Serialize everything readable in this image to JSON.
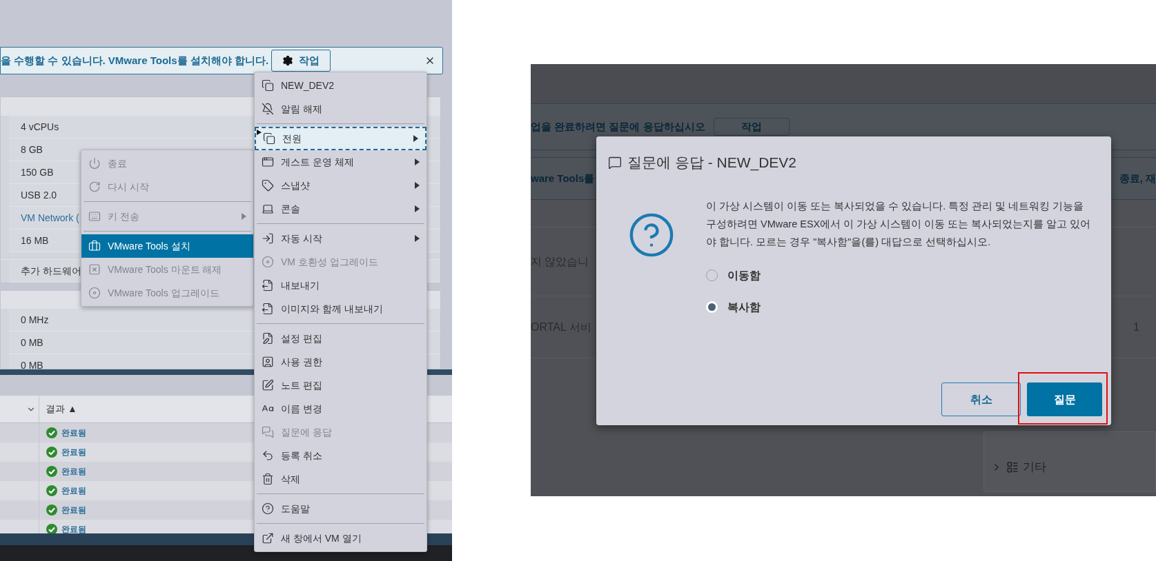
{
  "left_screen": {
    "banner": {
      "text": "을 수행할 수 있습니다. VMware Tools를 설치해야 합니다.",
      "action_button": "작업"
    },
    "hardware_rows": [
      {
        "value": "4 vCPUs",
        "kind": "text"
      },
      {
        "value": "8 GB",
        "kind": "text"
      },
      {
        "value": "150 GB",
        "kind": "text"
      },
      {
        "value": "USB 2.0",
        "kind": "text"
      },
      {
        "value": "VM Network (",
        "kind": "link"
      },
      {
        "value": "16 MB",
        "kind": "text"
      },
      {
        "value": "추가 하드웨어",
        "kind": "text"
      }
    ],
    "usage_rows": [
      "0 MHz",
      "0 MB",
      "0 MB"
    ],
    "tasks_table": {
      "columns": [
        "결과 ▲"
      ],
      "rows": [
        {
          "result": "완료됨"
        },
        {
          "result": "완료됨"
        },
        {
          "result": "완료됨"
        },
        {
          "result": "완료됨"
        },
        {
          "result": "완료됨"
        },
        {
          "result": "완료됨"
        }
      ]
    },
    "actions_menu": [
      {
        "kind": "item",
        "label": "NEW_DEV2",
        "disabled": false,
        "selected": false,
        "has_submenu": false
      },
      {
        "kind": "item",
        "label": "알림 해제",
        "disabled": false,
        "selected": false,
        "has_submenu": false
      },
      {
        "kind": "divider"
      },
      {
        "kind": "item",
        "label": "전원",
        "disabled": false,
        "selected": true,
        "has_submenu": true
      },
      {
        "kind": "item",
        "label": "게스트 운영 체제",
        "disabled": false,
        "selected": false,
        "has_submenu": true
      },
      {
        "kind": "item",
        "label": "스냅샷",
        "disabled": false,
        "selected": false,
        "has_submenu": true
      },
      {
        "kind": "item",
        "label": "콘솔",
        "disabled": false,
        "selected": false,
        "has_submenu": true
      },
      {
        "kind": "divider"
      },
      {
        "kind": "item",
        "label": "자동 시작",
        "disabled": false,
        "selected": false,
        "has_submenu": true
      },
      {
        "kind": "item",
        "label": "VM 호환성 업그레이드",
        "disabled": true,
        "selected": false,
        "has_submenu": false
      },
      {
        "kind": "item",
        "label": "내보내기",
        "disabled": false,
        "selected": false,
        "has_submenu": false
      },
      {
        "kind": "item",
        "label": "이미지와 함께 내보내기",
        "disabled": false,
        "selected": false,
        "has_submenu": false
      },
      {
        "kind": "divider"
      },
      {
        "kind": "item",
        "label": "설정 편집",
        "disabled": false,
        "selected": false,
        "has_submenu": false
      },
      {
        "kind": "item",
        "label": "사용 권한",
        "disabled": false,
        "selected": false,
        "has_submenu": false
      },
      {
        "kind": "item",
        "label": "노트 편집",
        "disabled": false,
        "selected": false,
        "has_submenu": false
      },
      {
        "kind": "item",
        "label": "이름 변경",
        "disabled": false,
        "selected": false,
        "has_submenu": false
      },
      {
        "kind": "item",
        "label": "질문에 응답",
        "disabled": true,
        "selected": false,
        "has_submenu": false
      },
      {
        "kind": "item",
        "label": "등록 취소",
        "disabled": false,
        "selected": false,
        "has_submenu": false
      },
      {
        "kind": "item",
        "label": "삭제",
        "disabled": false,
        "selected": false,
        "has_submenu": false
      },
      {
        "kind": "divider"
      },
      {
        "kind": "item",
        "label": "도움말",
        "disabled": false,
        "selected": false,
        "has_submenu": false
      },
      {
        "kind": "divider"
      },
      {
        "kind": "item",
        "label": "새 창에서 VM 열기",
        "disabled": false,
        "selected": false,
        "has_submenu": false
      }
    ],
    "power_submenu": [
      {
        "kind": "item",
        "label": "종료",
        "disabled": true,
        "selected": false,
        "has_submenu": false
      },
      {
        "kind": "item",
        "label": "다시 시작",
        "disabled": true,
        "selected": false,
        "has_submenu": false
      },
      {
        "kind": "divider"
      },
      {
        "kind": "item",
        "label": "키 전송",
        "disabled": true,
        "selected": false,
        "has_submenu": true
      },
      {
        "kind": "divider"
      },
      {
        "kind": "item",
        "label": "VMware Tools 설치",
        "disabled": false,
        "selected": true,
        "has_submenu": false
      },
      {
        "kind": "item",
        "label": "VMware Tools 마운트 해제",
        "disabled": true,
        "selected": false,
        "has_submenu": false
      },
      {
        "kind": "item",
        "label": "VMware Tools 업그레이드",
        "disabled": true,
        "selected": false,
        "has_submenu": false
      }
    ]
  },
  "right_screen": {
    "backdrop": {
      "banner_text": "업을 완료하려면 질문에 응답하십시오",
      "banner_button": "작업",
      "second_banner_left": "ware Tools를",
      "second_banner_right": "종료, 재",
      "row_text_1": "지 않았습니",
      "row_text_2": "ORTAL 서비",
      "row_text_3": "1",
      "card_item": "기타"
    },
    "dialog": {
      "title": "질문에 응답 - NEW_DEV2",
      "message": "이 가상 시스템이 이동 또는 복사되었을 수 있습니다. 특정 관리 및 네트워킹 기능을 구성하려면 VMware ESX에서 이 가상 시스템이 이동 또는 복사되었는지를 알고 있어야 합니다. 모르는 경우 \"복사함\"을(를) 대답으로 선택하십시오.",
      "options": [
        {
          "label": "이동함",
          "selected": false
        },
        {
          "label": "복사함",
          "selected": true
        }
      ],
      "buttons": [
        {
          "label": "취소",
          "kind": "secondary",
          "highlighted": false
        },
        {
          "label": "질문",
          "kind": "primary",
          "highlighted": true
        }
      ]
    }
  }
}
